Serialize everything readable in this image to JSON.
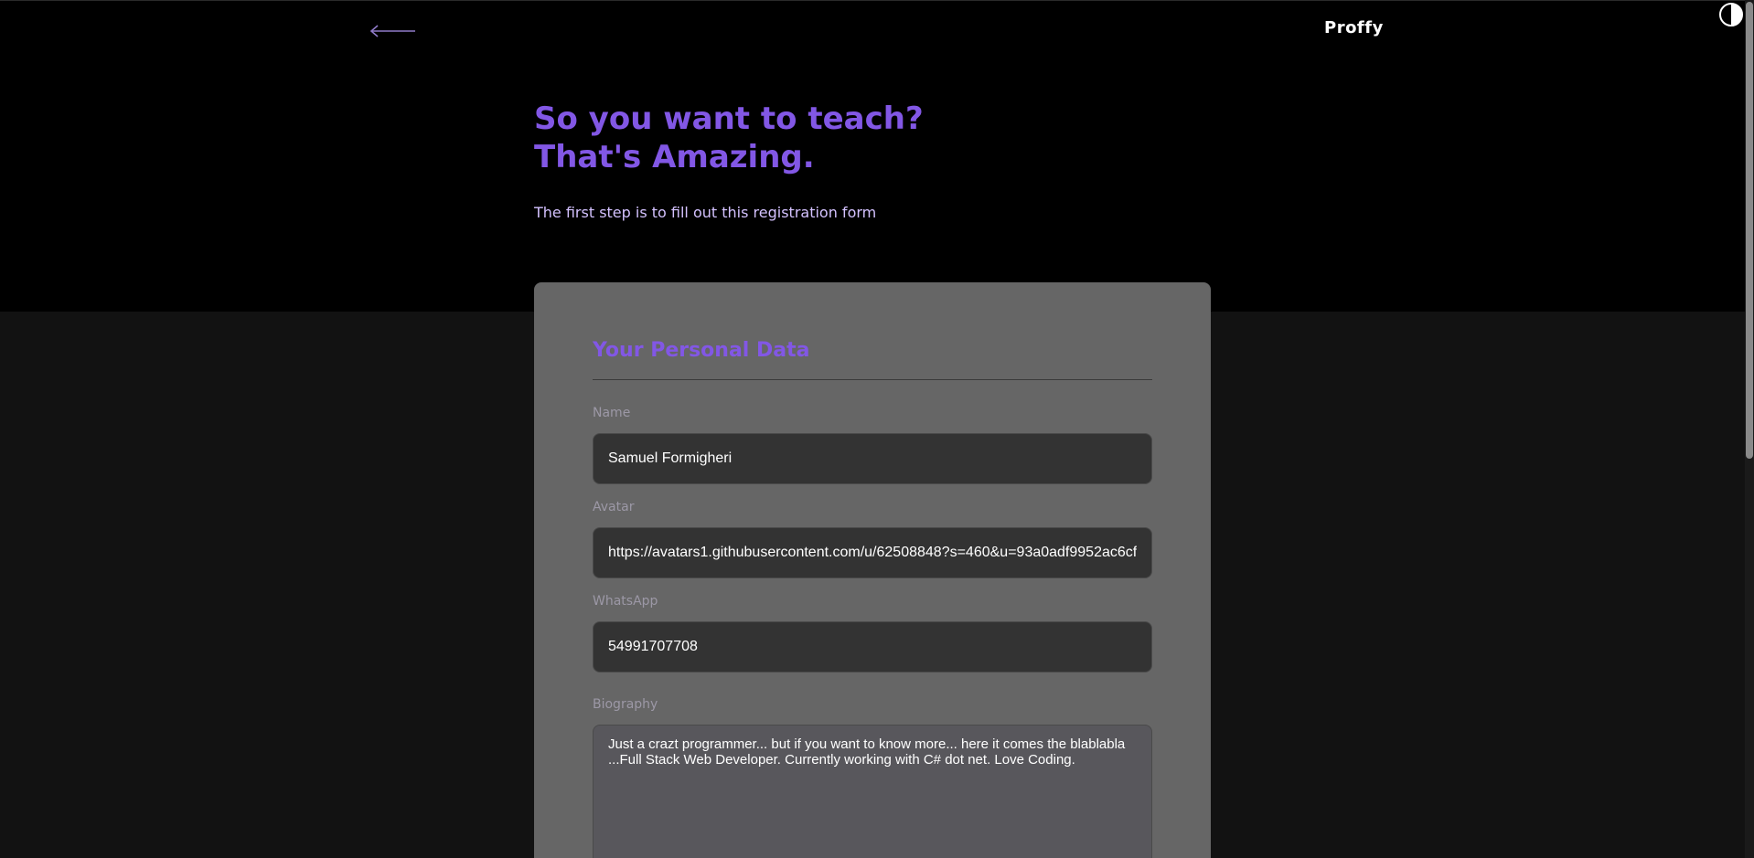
{
  "header": {
    "logo_text": "Proffy",
    "back_icon": "arrow-left-icon",
    "theme_icon": "contrast-toggle-icon"
  },
  "hero": {
    "title_line1": "So you want to teach?",
    "title_line2": "That's Amazing.",
    "subtitle": "The first step is to fill out this registration form"
  },
  "form": {
    "section_title": "Your Personal Data",
    "fields": {
      "name": {
        "label": "Name",
        "value": "Samuel Formigheri"
      },
      "avatar": {
        "label": "Avatar",
        "value": "https://avatars1.githubusercontent.com/u/62508848?s=460&u=93a0adf9952ac6cf"
      },
      "whatsapp": {
        "label": "WhatsApp",
        "value": "54991707708"
      },
      "biography": {
        "label": "Biography",
        "value": "Just a crazt programmer... but if you want to know more... here it comes the blablabla ...Full Stack Web Developer. Currently working with C# dot net. Love Coding."
      }
    }
  },
  "colors": {
    "accent": "#8257e5",
    "hero_background": "#000000",
    "page_background": "#121212",
    "card_background": "#666666",
    "input_background": "#333333"
  }
}
